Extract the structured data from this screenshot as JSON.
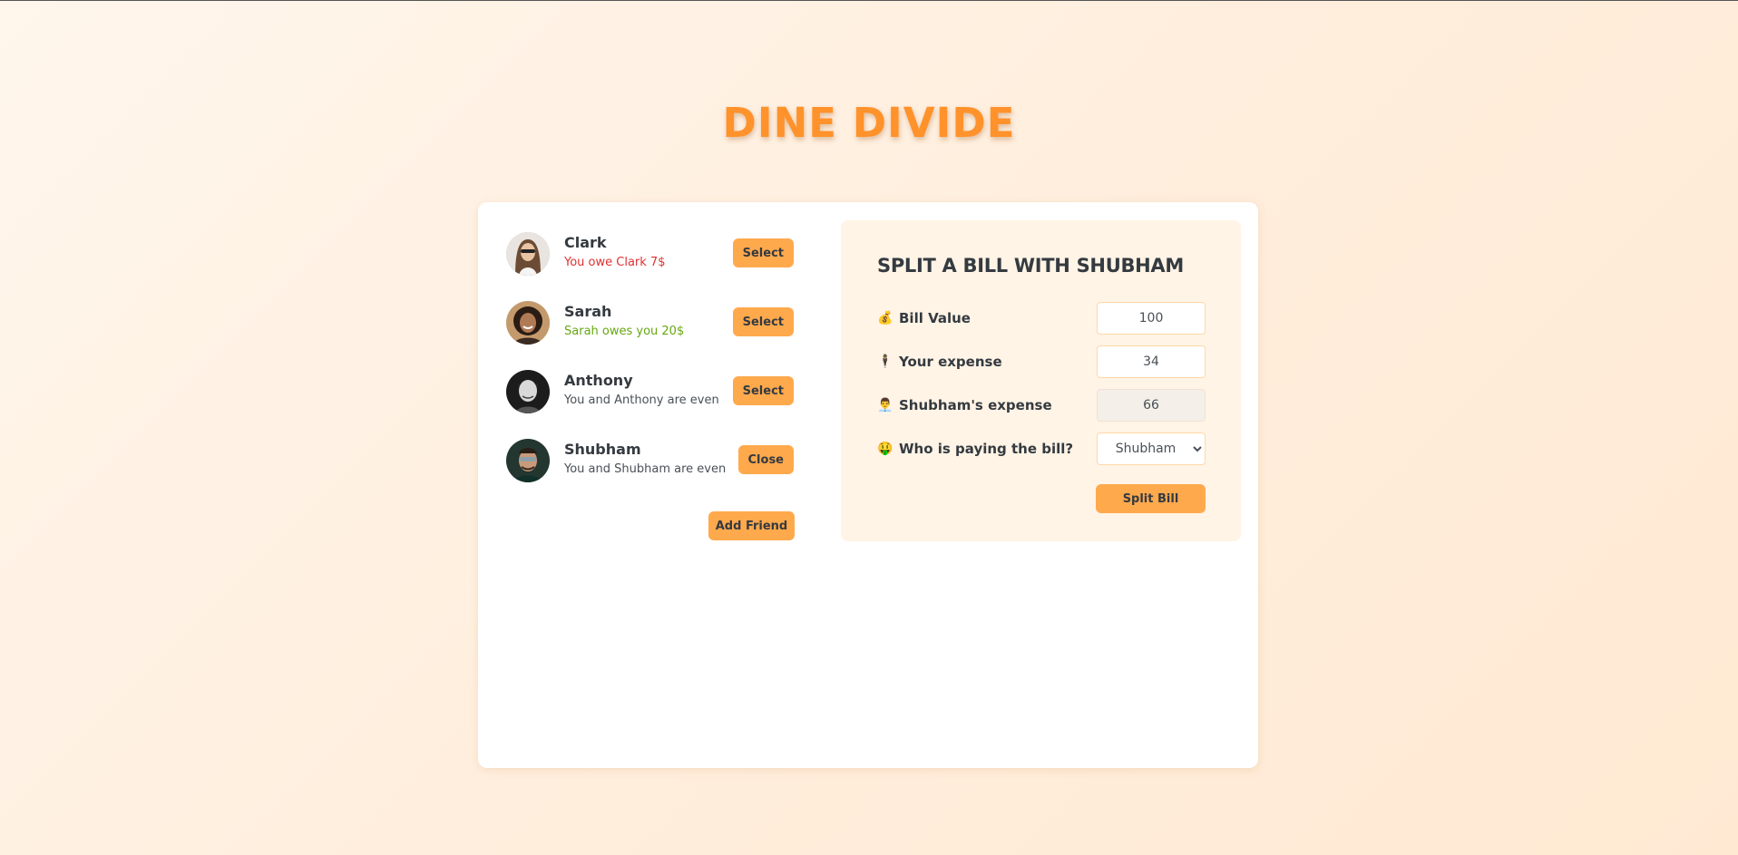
{
  "app": {
    "title": "DINE DIVIDE"
  },
  "friends": [
    {
      "name": "Clark",
      "status": "You owe Clark 7$",
      "tone": "red",
      "button": "Select"
    },
    {
      "name": "Sarah",
      "status": "Sarah owes you 20$",
      "tone": "green",
      "button": "Select"
    },
    {
      "name": "Anthony",
      "status": "You and Anthony are even",
      "tone": "neutral",
      "button": "Select"
    },
    {
      "name": "Shubham",
      "status": "You and Shubham are even",
      "tone": "neutral",
      "button": "Close"
    }
  ],
  "add_friend_label": "Add Friend",
  "split_form": {
    "title": "SPLIT A BILL WITH SHUBHAM",
    "bill_value": {
      "icon": "💰",
      "label": "Bill Value",
      "value": "100"
    },
    "your_expense": {
      "icon": "🕴",
      "label": "Your expense",
      "value": "34"
    },
    "friend_expense": {
      "icon": "👨‍💼",
      "label": "Shubham's expense",
      "value": "66"
    },
    "payer": {
      "icon": "🤑",
      "label": "Who is paying the bill?",
      "options": [
        "Shubham"
      ],
      "selected": "Shubham"
    },
    "submit_label": "Split Bill"
  },
  "colors": {
    "accent": "#ffa94d",
    "title": "#ff922b",
    "owe": "#e03131",
    "owed": "#66a80f",
    "form_bg": "#fff4e6"
  }
}
